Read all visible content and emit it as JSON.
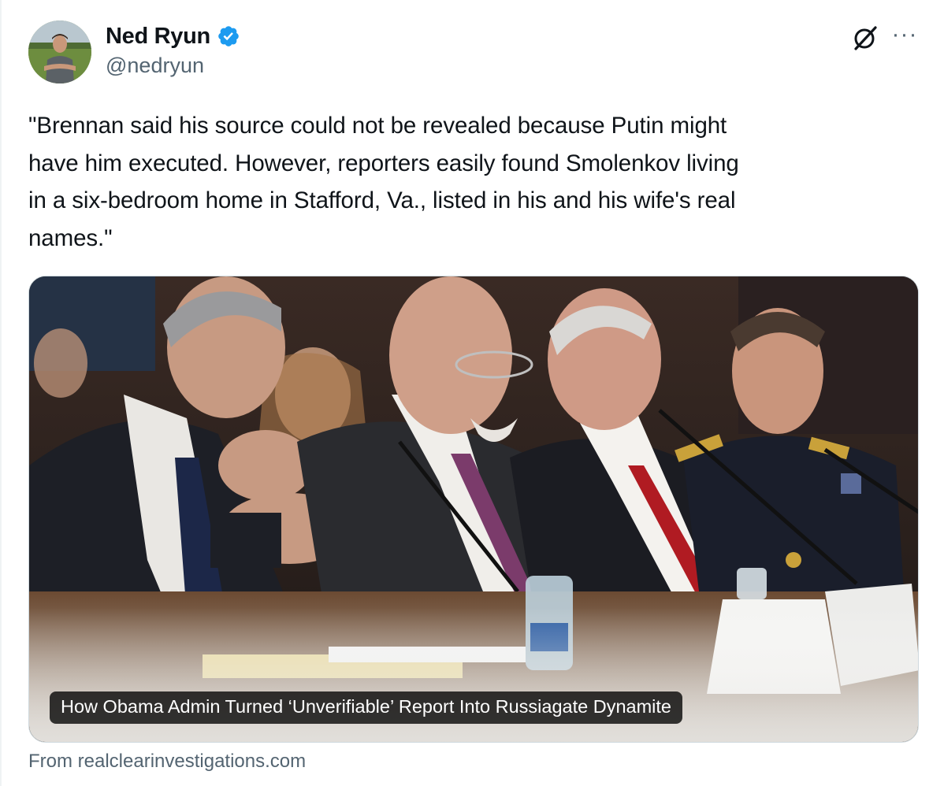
{
  "author": {
    "name": "Ned Ryun",
    "handle": "@nedryun",
    "verified_icon": "verified-badge-icon",
    "verified_color": "#1d9bf0"
  },
  "actions": {
    "grok_icon": "grok-icon",
    "more_icon": "more-options-icon",
    "more_label": "···"
  },
  "tweet": {
    "text": "\"Brennan said his source could not be revealed because Putin might\nhave him executed. However, reporters easily found Smolenkov living\nin a six-bedroom home in Stafford, Va., listed in his and his wife's real\nnames.\""
  },
  "card": {
    "headline": "How Obama Admin Turned ‘Unverifiable’ Report Into Russiagate Dynamite",
    "image_icon": "hearing-photo",
    "source": "From realclearinvestigations.com"
  },
  "colors": {
    "text_primary": "#0f1419",
    "text_secondary": "#536471",
    "border": "#cfd9de"
  }
}
